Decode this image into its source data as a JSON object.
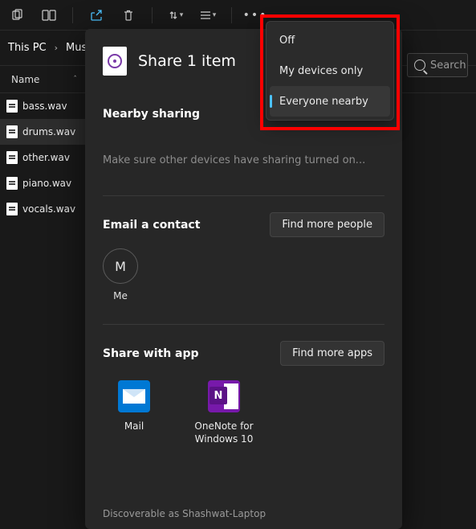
{
  "toolbar": {
    "icons": [
      "copy",
      "layout",
      "share",
      "delete",
      "sort",
      "view",
      "more"
    ]
  },
  "breadcrumbs": [
    "This PC",
    "Music"
  ],
  "columns": {
    "name": "Name"
  },
  "files": [
    {
      "name": "bass.wav",
      "selected": false
    },
    {
      "name": "drums.wav",
      "selected": true
    },
    {
      "name": "other.wav",
      "selected": false
    },
    {
      "name": "piano.wav",
      "selected": false
    },
    {
      "name": "vocals.wav",
      "selected": false
    }
  ],
  "search": {
    "placeholder": "Search"
  },
  "share_panel": {
    "title": "Share 1 item",
    "nearby_title": "Nearby sharing",
    "nearby_hint": "Make sure other devices have sharing turned on...",
    "email_title": "Email a contact",
    "find_people": "Find more people",
    "contact_letter": "M",
    "contact_label": "Me",
    "apps_title": "Share with app",
    "find_apps": "Find more apps",
    "apps": [
      {
        "name": "Mail"
      },
      {
        "name": "OneNote for Windows 10"
      }
    ],
    "discoverable": "Discoverable as Shashwat-Laptop"
  },
  "dropdown": {
    "items": [
      {
        "label": "Off",
        "selected": false
      },
      {
        "label": "My devices only",
        "selected": false
      },
      {
        "label": "Everyone nearby",
        "selected": true
      }
    ]
  }
}
